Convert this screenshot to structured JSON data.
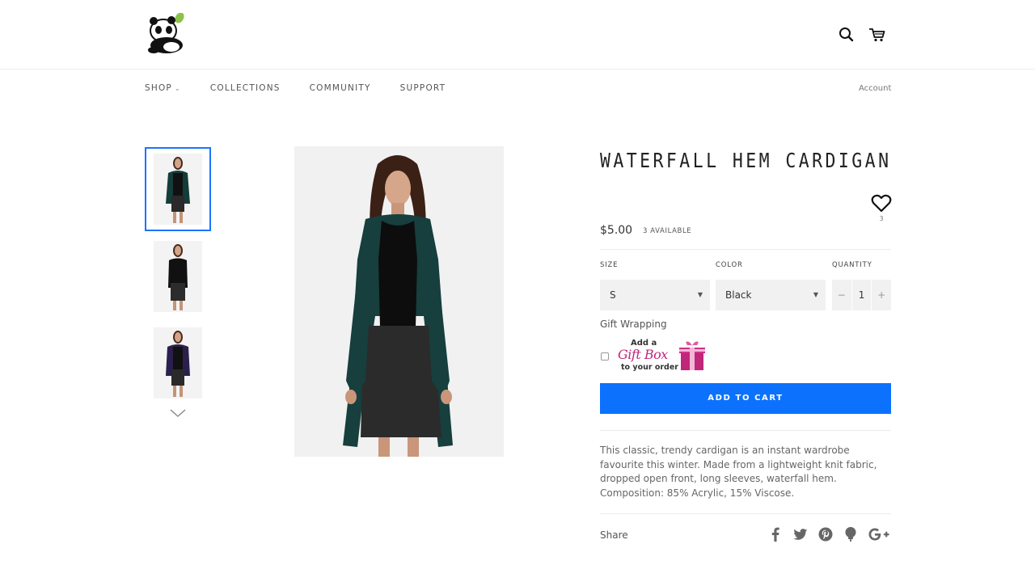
{
  "header": {
    "logo_alt": "Panda logo",
    "search_icon": "search-icon",
    "cart_icon": "cart-icon"
  },
  "nav": {
    "items": [
      {
        "label": "SHOP",
        "has_dropdown": true
      },
      {
        "label": "COLLECTIONS"
      },
      {
        "label": "COMMUNITY"
      },
      {
        "label": "SUPPORT"
      }
    ],
    "account": "Account"
  },
  "gallery": {
    "active_thumb": 0,
    "thumbs": [
      "thumbnail-1",
      "thumbnail-2",
      "thumbnail-3"
    ],
    "next_icon": "chevron-down-icon"
  },
  "product": {
    "title": "WATERFALL HEM CARDIGAN",
    "wishlist_count": "3",
    "price": "$5.00",
    "availability": "3 AVAILABLE",
    "size_label": "SIZE",
    "size_value": "S",
    "color_label": "COLOR",
    "color_value": "Black",
    "quantity_label": "QUANTITY",
    "quantity_value": "1",
    "qty_minus": "−",
    "qty_plus": "+",
    "gift_wrapping_label": "Gift Wrapping",
    "gift_add": "Add a",
    "gift_box": "Gift Box",
    "gift_order": "to your order",
    "add_to_cart": "ADD TO CART",
    "description": "This classic, trendy cardigan is an instant wardrobe favourite this winter. Made from a lightweight knit fabric, dropped open front, long sleeves, waterfall hem. Composition: 85% Acrylic, 15% Viscose.",
    "share_label": "Share"
  },
  "share_icons": [
    "facebook-icon",
    "twitter-icon",
    "pinterest-icon",
    "fancy-icon",
    "google-plus-icon"
  ],
  "colors": {
    "accent": "#0c72fe",
    "thumb_border": "#1b74ff",
    "gift_pink": "#c0267a"
  }
}
